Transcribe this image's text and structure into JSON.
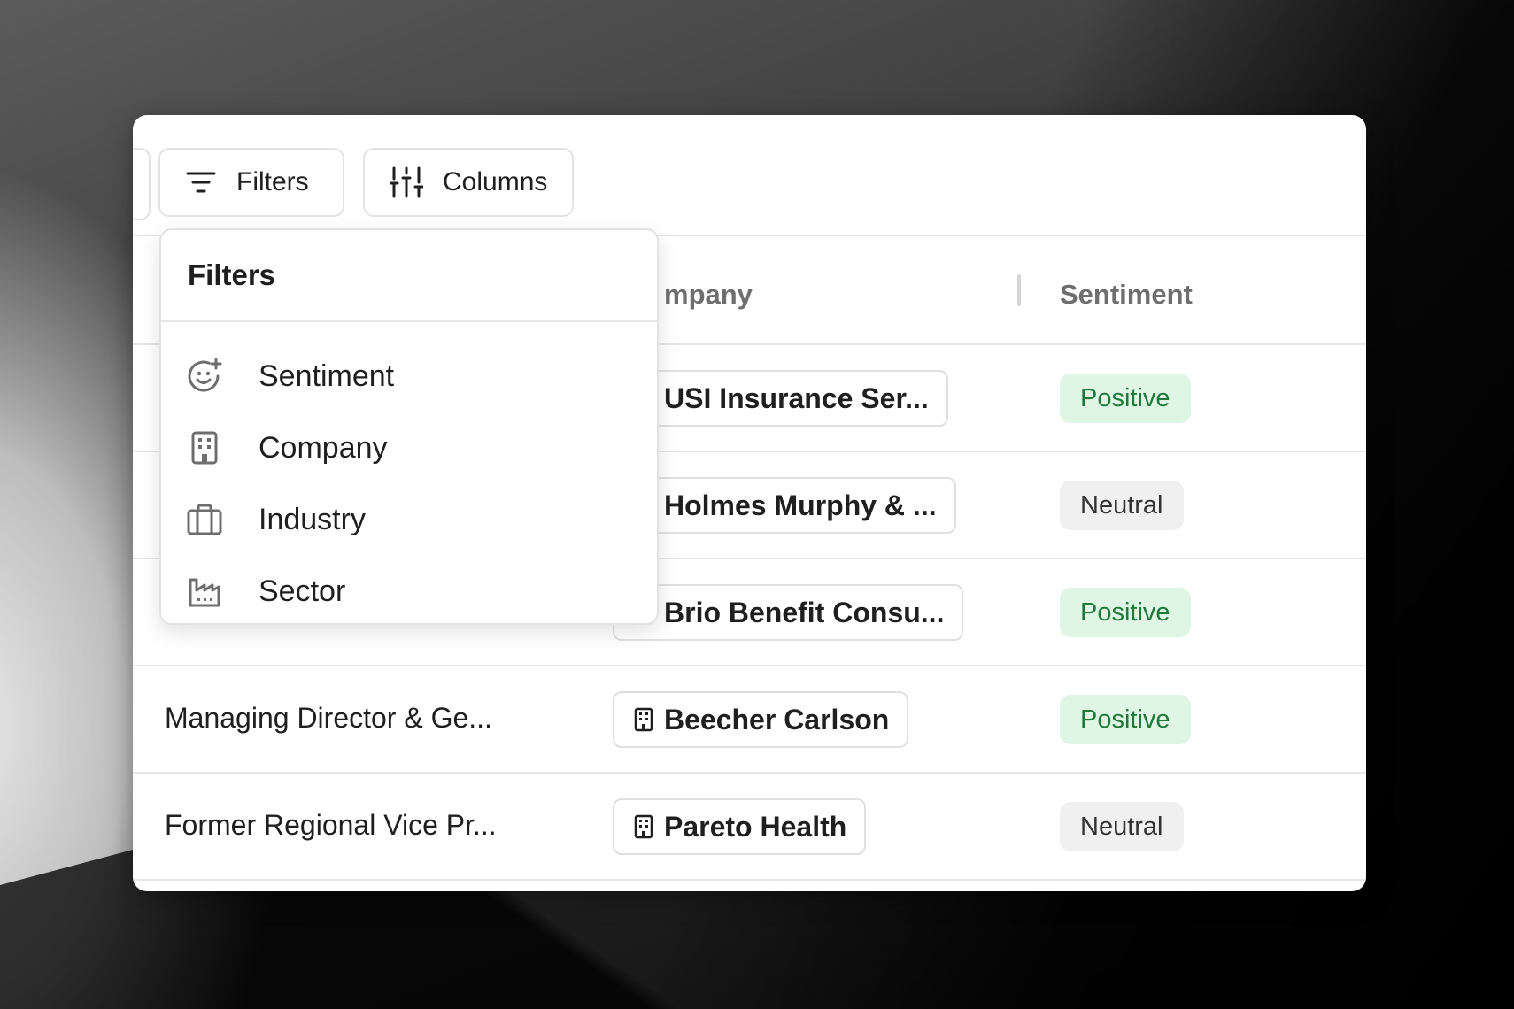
{
  "toolbar": {
    "filters_label": "Filters",
    "columns_label": "Columns"
  },
  "table": {
    "columns": {
      "company": "mpany",
      "sentiment": "Sentiment"
    },
    "rows": [
      {
        "title": "",
        "company": "USI Insurance Ser...",
        "sentiment": "Positive"
      },
      {
        "title": "",
        "company": "Holmes Murphy & ...",
        "sentiment": "Neutral"
      },
      {
        "title": "",
        "company": "Brio Benefit Consu...",
        "sentiment": "Positive"
      },
      {
        "title": "Managing Director & Ge...",
        "company": "Beecher Carlson",
        "sentiment": "Positive"
      },
      {
        "title": "Former Regional Vice Pr...",
        "company": "Pareto Health",
        "sentiment": "Neutral"
      }
    ]
  },
  "filters_menu": {
    "title": "Filters",
    "items": [
      {
        "label": "Sentiment",
        "icon": "smiley-plus-icon"
      },
      {
        "label": "Company",
        "icon": "building-icon"
      },
      {
        "label": "Industry",
        "icon": "briefcase-icon"
      },
      {
        "label": "Sector",
        "icon": "factory-icon"
      }
    ]
  },
  "colors": {
    "positive_bg": "#dff6e5",
    "positive_text": "#1f7a3a",
    "neutral_bg": "#f0f0f0",
    "neutral_text": "#333333"
  }
}
